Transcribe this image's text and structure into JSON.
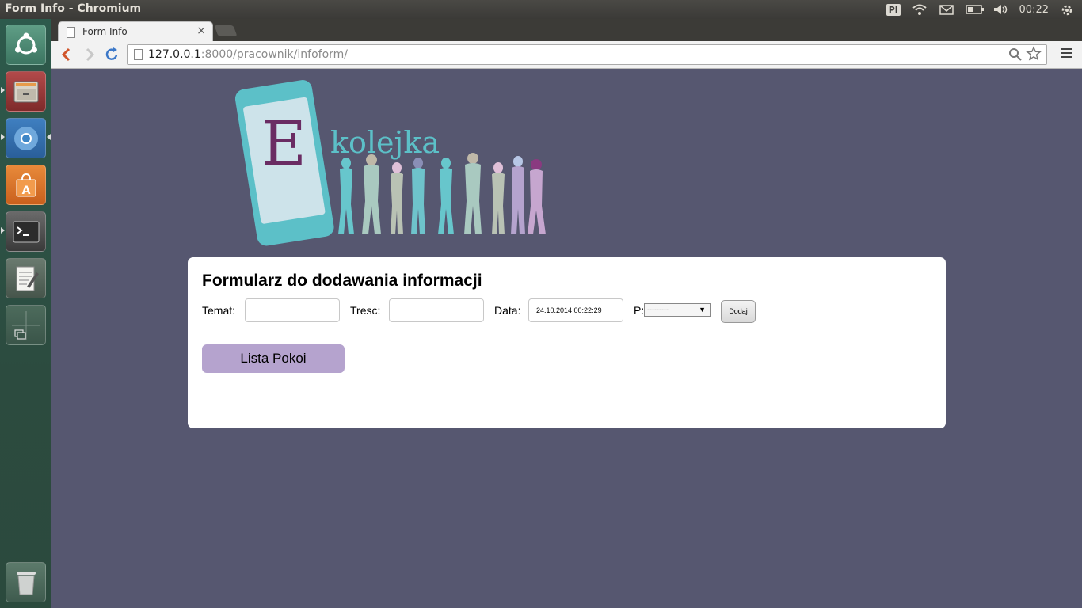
{
  "window": {
    "title": "Form Info - Chromium"
  },
  "panel": {
    "keyboard_layout": "Pl",
    "clock": "00:22"
  },
  "launcher": {
    "items": [
      "ubuntu-dash",
      "files",
      "chromium",
      "software-center",
      "terminal",
      "text-editor",
      "workspace-switcher",
      "trash"
    ]
  },
  "browser": {
    "tab_title": "Form Info",
    "tab_close": "×",
    "url_host": "127.0.0.1",
    "url_rest": ":8000/pracownik/infoform/"
  },
  "logo": {
    "letter": "E",
    "word": "kolejka"
  },
  "form": {
    "heading": "Formularz do dodawania informacji",
    "temat_label": "Temat:",
    "temat_value": "",
    "tresc_label": "Tresc:",
    "tresc_value": "",
    "data_label": "Data:",
    "data_value": "24.10.2014 00:22:29",
    "p_label": "P:",
    "p_selected": "---------",
    "submit_label": "Dodaj",
    "lista_label": "Lista Pokoi"
  },
  "colors": {
    "page_bg": "#565770",
    "lista_button": "#b5a3ce",
    "logo_teal": "#5cc0c8",
    "logo_purple": "#6a2c63"
  }
}
